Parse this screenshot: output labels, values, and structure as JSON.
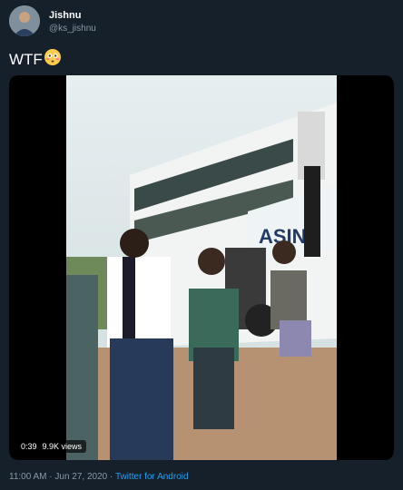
{
  "tweet": {
    "author_name": "Jishnu",
    "author_handle": "@ks_jishnu",
    "text": "WTF",
    "emoji_icon": "flushed-face-emoji"
  },
  "media": {
    "type": "video",
    "duration": "0:39",
    "views": "9.9K views"
  },
  "footer": {
    "time": "11:00 AM",
    "separator": " · ",
    "date": "Jun 27, 2020",
    "separator2": " · ",
    "source": "Twitter for Android"
  },
  "colors": {
    "background": "#15202b",
    "secondary_text": "#8899a6",
    "link": "#1da1f2"
  }
}
